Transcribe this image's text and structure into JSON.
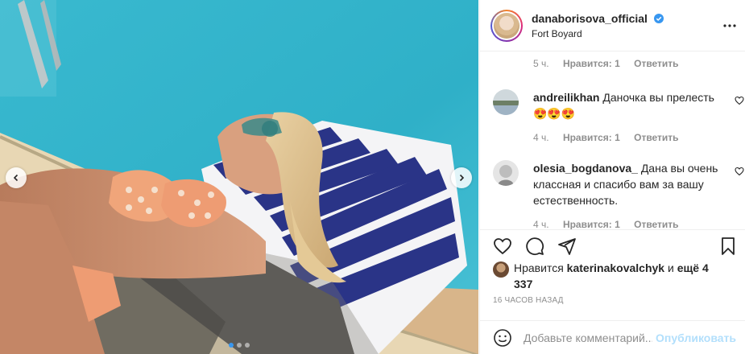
{
  "post": {
    "username": "danaborisova_official",
    "location": "Fort Boyard",
    "icons": {
      "verified": "verified-badge-icon",
      "more": "more-options-icon",
      "prev": "chevron-left-icon",
      "next": "chevron-right-icon"
    },
    "carousel": {
      "slide_count": 3,
      "active_index": 0
    }
  },
  "comments": [
    {
      "username": "",
      "text": "",
      "time": "5 ч.",
      "likes": "Нравится: 1",
      "reply": "Ответить"
    },
    {
      "username": "andreilikhan",
      "text": "Даночка вы прелесть😍😍😍",
      "time": "4 ч.",
      "likes": "Нравится: 1",
      "reply": "Ответить"
    },
    {
      "username": "olesia_bogdanova_",
      "text": "Дана вы очень классная и спасибо вам за вашу естественность.",
      "time": "4 ч.",
      "likes": "Нравится: 1",
      "reply": "Ответить"
    }
  ],
  "actions": {
    "like_icon": "heart-icon",
    "comment_icon": "comment-icon",
    "share_icon": "share-icon",
    "save_icon": "bookmark-icon"
  },
  "likes": {
    "prefix": "Нравится",
    "user": "katerinakovalchyk",
    "joiner": "и",
    "count_text": "ещё 4 337"
  },
  "time_ago": "16 ЧАСОВ НАЗАД",
  "comment_box": {
    "placeholder": "Добавьте комментарий...",
    "publish_label": "Опубликовать",
    "emoji_icon": "emoji-icon"
  },
  "colors": {
    "accent": "#3897f0",
    "publish_disabled": "#b2dffc",
    "muted": "#8e8e8e",
    "text": "#262626"
  }
}
